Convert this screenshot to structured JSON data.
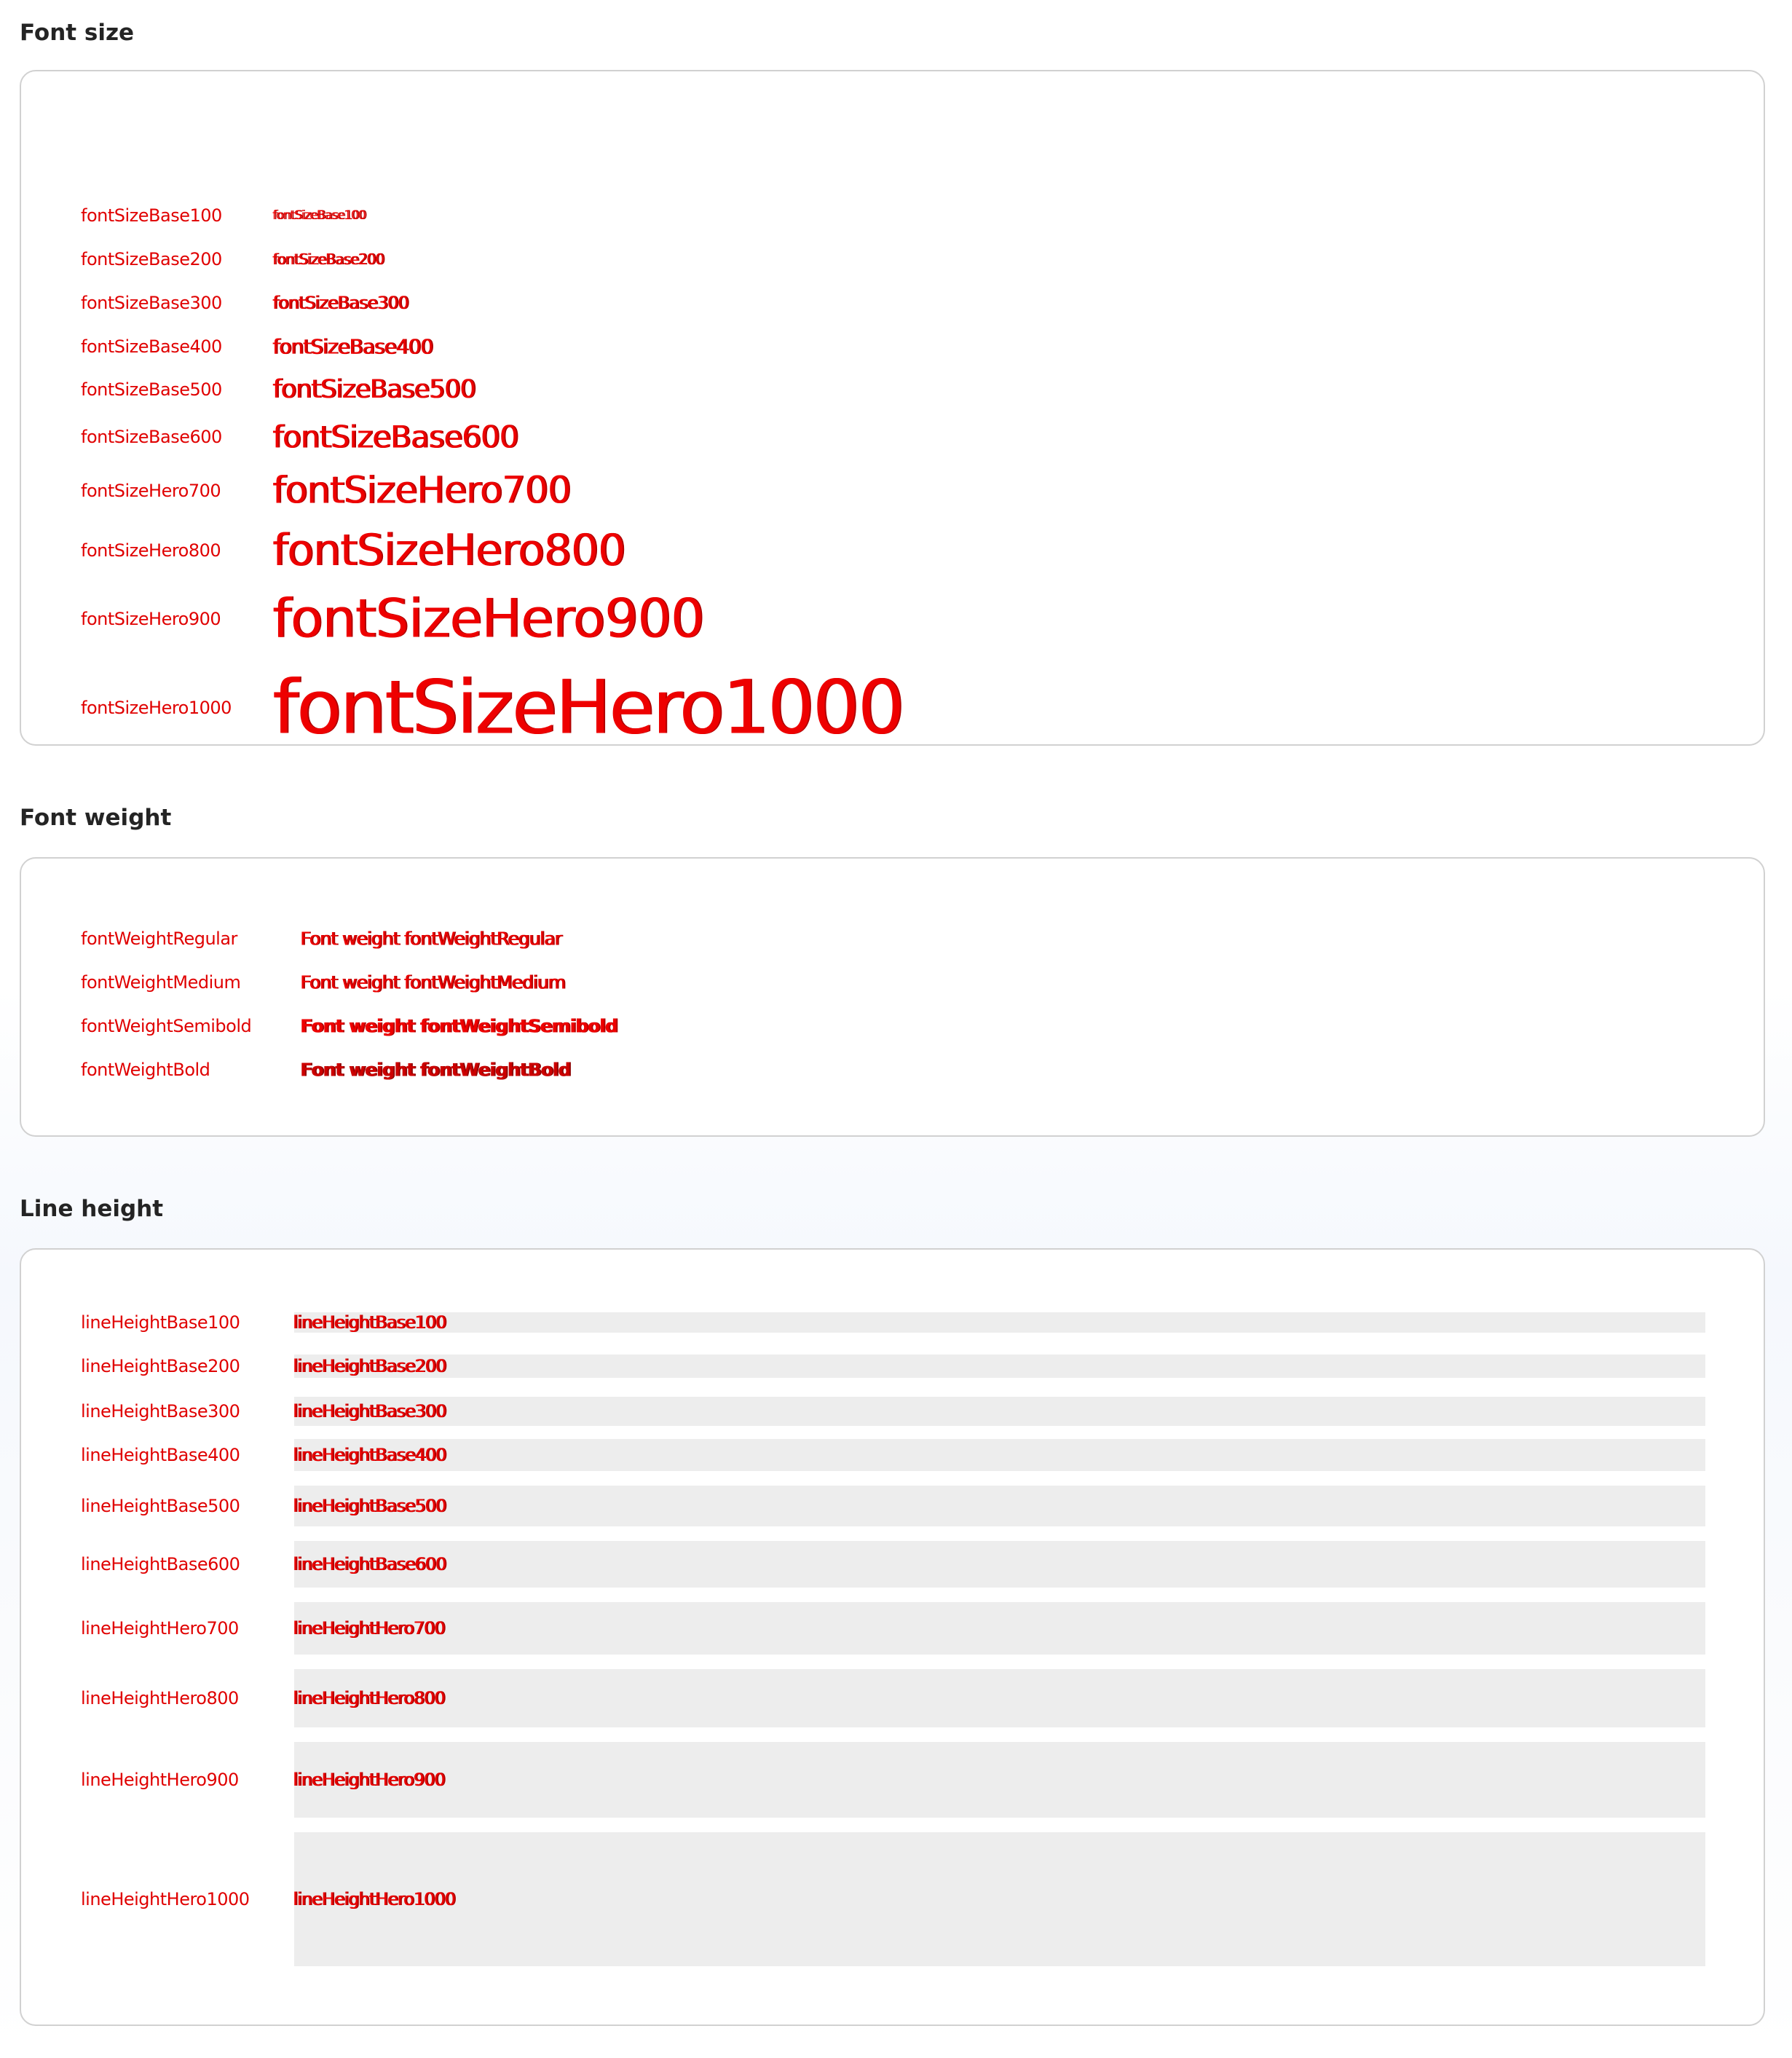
{
  "sections": {
    "font_size": {
      "title": "Font size",
      "rows": [
        {
          "label": "fontSizeBase100",
          "sample": "fontSizeBase100"
        },
        {
          "label": "fontSizeBase200",
          "sample": "fontSizeBase200"
        },
        {
          "label": "fontSizeBase300",
          "sample": "fontSizeBase300"
        },
        {
          "label": "fontSizeBase400",
          "sample": "fontSizeBase400"
        },
        {
          "label": "fontSizeBase500",
          "sample": "fontSizeBase500"
        },
        {
          "label": "fontSizeBase600",
          "sample": "fontSizeBase600"
        },
        {
          "label": "fontSizeHero700",
          "sample": "fontSizeHero700"
        },
        {
          "label": "fontSizeHero800",
          "sample": "fontSizeHero800"
        },
        {
          "label": "fontSizeHero900",
          "sample": "fontSizeHero900"
        },
        {
          "label": "fontSizeHero1000",
          "sample": "fontSizeHero1000"
        }
      ]
    },
    "font_weight": {
      "title": "Font weight",
      "rows": [
        {
          "label": "fontWeightRegular",
          "sample": "Font weight fontWeightRegular"
        },
        {
          "label": "fontWeightMedium",
          "sample": "Font weight fontWeightMedium"
        },
        {
          "label": "fontWeightSemibold",
          "sample": "Font weight fontWeightSemibold"
        },
        {
          "label": "fontWeightBold",
          "sample": "Font weight fontWeightBold"
        }
      ]
    },
    "line_height": {
      "title": "Line height",
      "rows": [
        {
          "label": "lineHeightBase100",
          "sample": "lineHeightBase100"
        },
        {
          "label": "lineHeightBase200",
          "sample": "lineHeightBase200"
        },
        {
          "label": "lineHeightBase300",
          "sample": "lineHeightBase300"
        },
        {
          "label": "lineHeightBase400",
          "sample": "lineHeightBase400"
        },
        {
          "label": "lineHeightBase500",
          "sample": "lineHeightBase500"
        },
        {
          "label": "lineHeightBase600",
          "sample": "lineHeightBase600"
        },
        {
          "label": "lineHeightHero700",
          "sample": "lineHeightHero700"
        },
        {
          "label": "lineHeightHero800",
          "sample": "lineHeightHero800"
        },
        {
          "label": "lineHeightHero900",
          "sample": "lineHeightHero900"
        },
        {
          "label": "lineHeightHero1000",
          "sample": "lineHeightHero1000"
        }
      ]
    }
  }
}
